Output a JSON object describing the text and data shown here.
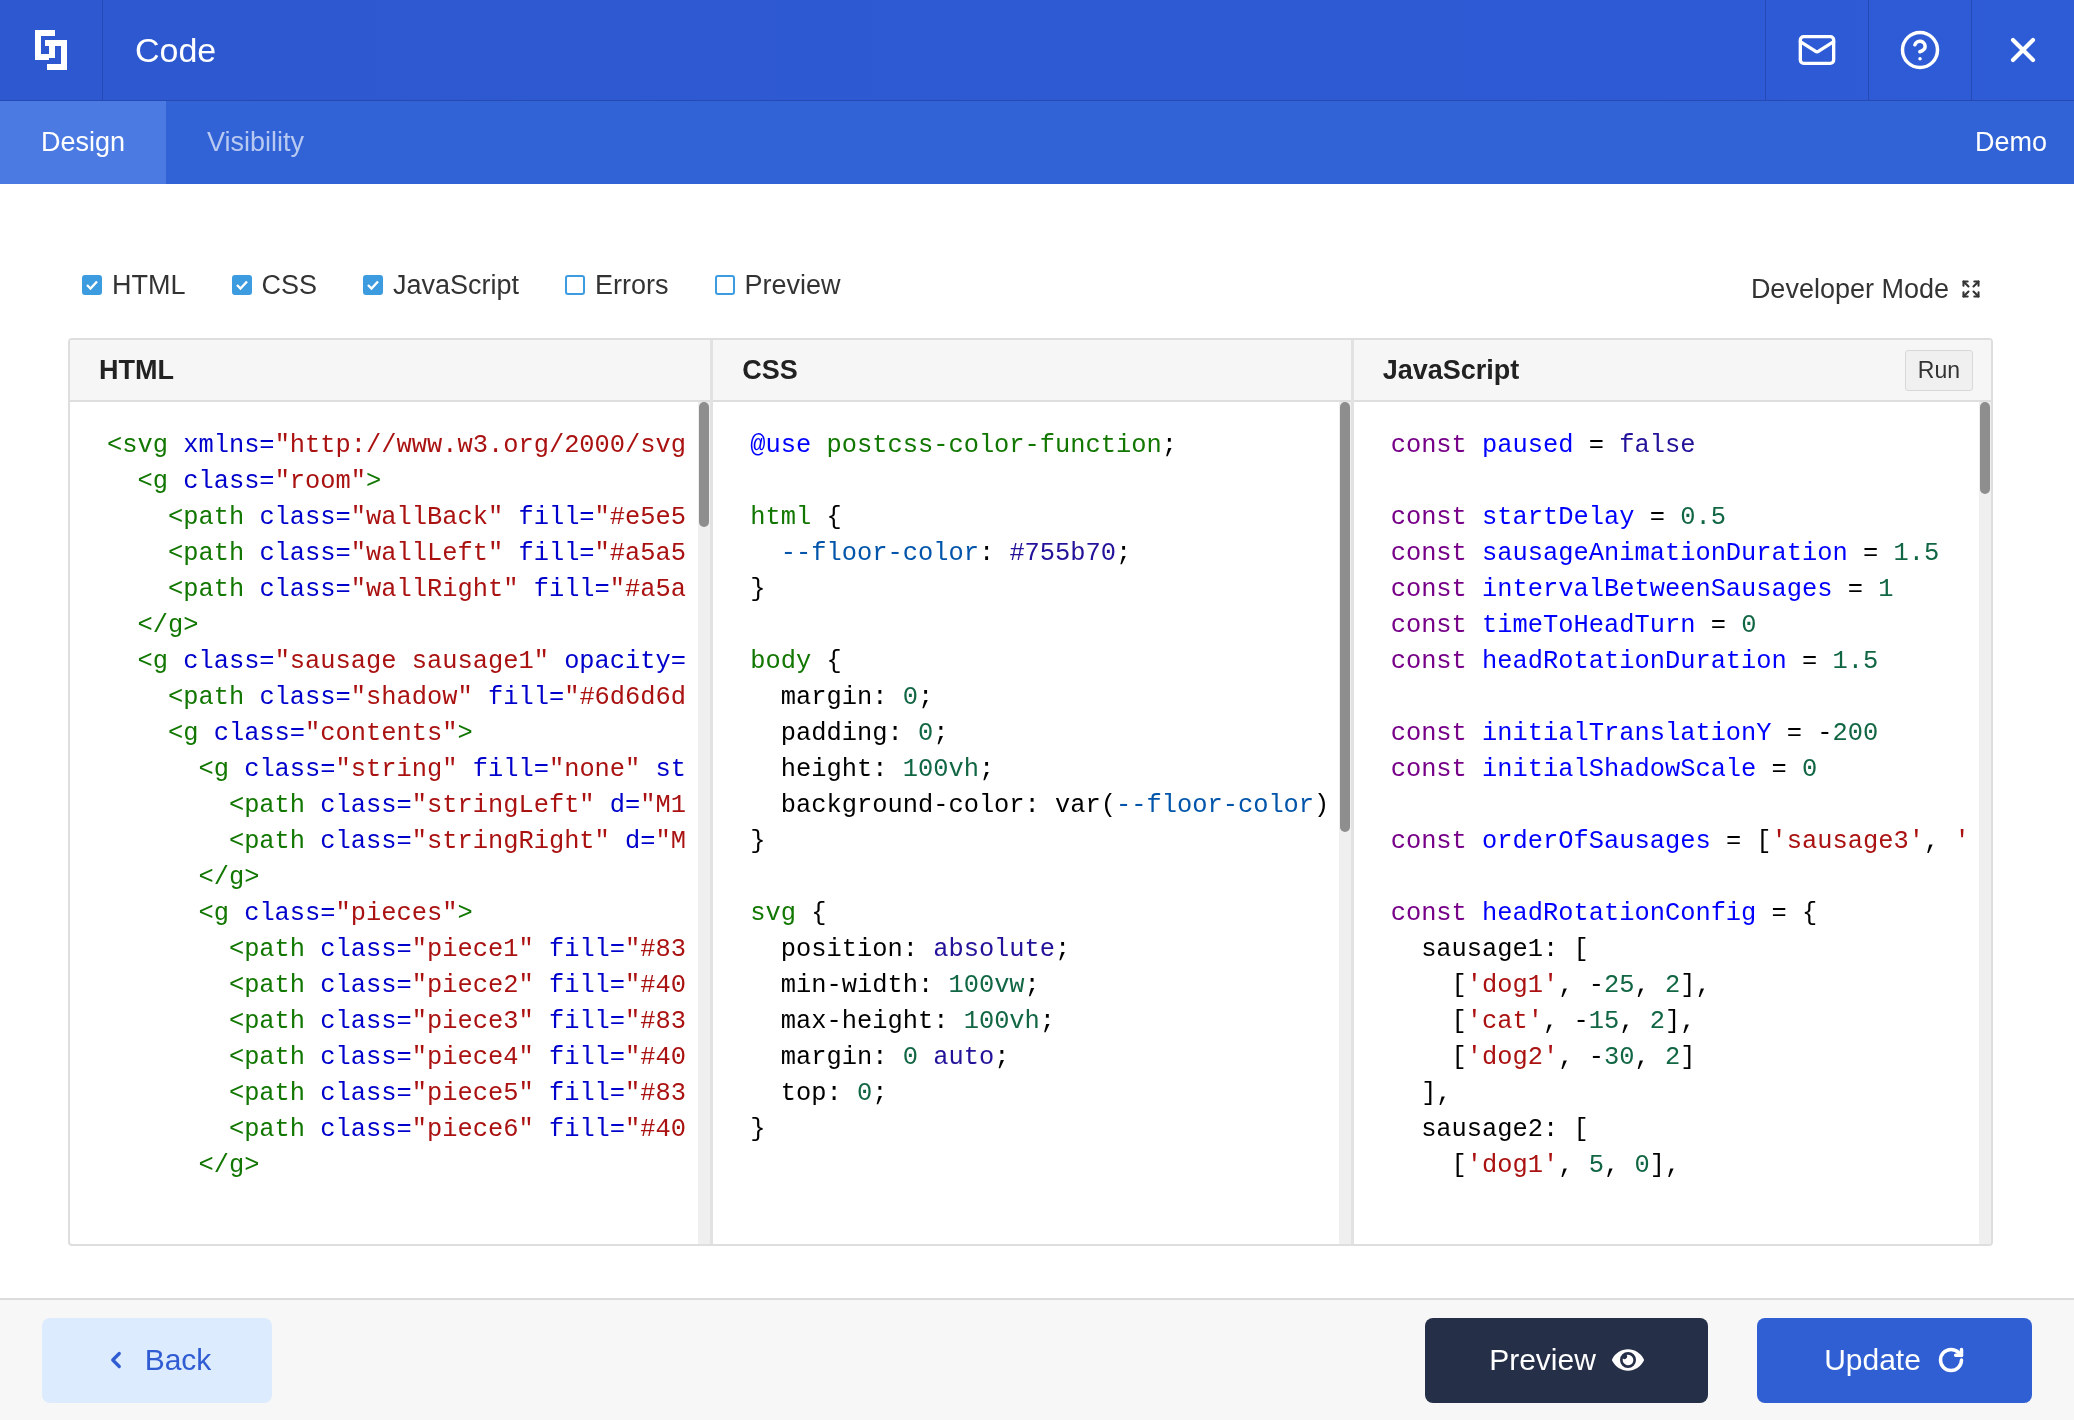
{
  "header": {
    "title": "Code"
  },
  "tabs": [
    {
      "label": "Design",
      "selected": true
    },
    {
      "label": "Visibility",
      "selected": false
    }
  ],
  "demo_label": "Demo",
  "toggles": [
    {
      "label": "HTML",
      "checked": true
    },
    {
      "label": "CSS",
      "checked": true
    },
    {
      "label": "JavaScript",
      "checked": true
    },
    {
      "label": "Errors",
      "checked": false
    },
    {
      "label": "Preview",
      "checked": false
    }
  ],
  "developer_mode": {
    "label": "Developer Mode"
  },
  "editors": [
    {
      "title": "HTML",
      "lines": [
        {
          "tokens": [
            {
              "kind": "tag",
              "text": "<svg"
            },
            {
              "kind": "attribute",
              "text": " xmlns="
            },
            {
              "kind": "string",
              "text": "\"http://www.w3.org/2000/svg"
            }
          ]
        },
        {
          "tokens": [
            {
              "kind": "tag",
              "text": "  <g"
            },
            {
              "kind": "attribute",
              "text": " class="
            },
            {
              "kind": "string",
              "text": "\"room\""
            },
            {
              "kind": "tag",
              "text": ">"
            }
          ]
        },
        {
          "tokens": [
            {
              "kind": "tag",
              "text": "    <path"
            },
            {
              "kind": "attribute",
              "text": " class="
            },
            {
              "kind": "string",
              "text": "\"wallBack\""
            },
            {
              "kind": "attribute",
              "text": " fill="
            },
            {
              "kind": "string",
              "text": "\"#e5e5"
            }
          ]
        },
        {
          "tokens": [
            {
              "kind": "tag",
              "text": "    <path"
            },
            {
              "kind": "attribute",
              "text": " class="
            },
            {
              "kind": "string",
              "text": "\"wallLeft\""
            },
            {
              "kind": "attribute",
              "text": " fill="
            },
            {
              "kind": "string",
              "text": "\"#a5a5"
            }
          ]
        },
        {
          "tokens": [
            {
              "kind": "tag",
              "text": "    <path"
            },
            {
              "kind": "attribute",
              "text": " class="
            },
            {
              "kind": "string",
              "text": "\"wallRight\""
            },
            {
              "kind": "attribute",
              "text": " fill="
            },
            {
              "kind": "string",
              "text": "\"#a5a"
            }
          ]
        },
        {
          "tokens": [
            {
              "kind": "tag",
              "text": "  </g>"
            }
          ]
        },
        {
          "tokens": [
            {
              "kind": "tag",
              "text": "  <g"
            },
            {
              "kind": "attribute",
              "text": " class="
            },
            {
              "kind": "string",
              "text": "\"sausage sausage1\""
            },
            {
              "kind": "attribute",
              "text": " opacity="
            }
          ]
        },
        {
          "tokens": [
            {
              "kind": "tag",
              "text": "    <path"
            },
            {
              "kind": "attribute",
              "text": " class="
            },
            {
              "kind": "string",
              "text": "\"shadow\""
            },
            {
              "kind": "attribute",
              "text": " fill="
            },
            {
              "kind": "string",
              "text": "\"#6d6d6d"
            }
          ]
        },
        {
          "tokens": [
            {
              "kind": "tag",
              "text": "    <g"
            },
            {
              "kind": "attribute",
              "text": " class="
            },
            {
              "kind": "string",
              "text": "\"contents\""
            },
            {
              "kind": "tag",
              "text": ">"
            }
          ]
        },
        {
          "tokens": [
            {
              "kind": "tag",
              "text": "      <g"
            },
            {
              "kind": "attribute",
              "text": " class="
            },
            {
              "kind": "string",
              "text": "\"string\""
            },
            {
              "kind": "attribute",
              "text": " fill="
            },
            {
              "kind": "string",
              "text": "\"none\""
            },
            {
              "kind": "attribute",
              "text": " st"
            }
          ]
        },
        {
          "tokens": [
            {
              "kind": "tag",
              "text": "        <path"
            },
            {
              "kind": "attribute",
              "text": " class="
            },
            {
              "kind": "string",
              "text": "\"stringLeft\""
            },
            {
              "kind": "attribute",
              "text": " d="
            },
            {
              "kind": "string",
              "text": "\"M1"
            }
          ]
        },
        {
          "tokens": [
            {
              "kind": "tag",
              "text": "        <path"
            },
            {
              "kind": "attribute",
              "text": " class="
            },
            {
              "kind": "string",
              "text": "\"stringRight\""
            },
            {
              "kind": "attribute",
              "text": " d="
            },
            {
              "kind": "string",
              "text": "\"M"
            }
          ]
        },
        {
          "tokens": [
            {
              "kind": "tag",
              "text": "      </g>"
            }
          ]
        },
        {
          "tokens": [
            {
              "kind": "tag",
              "text": "      <g"
            },
            {
              "kind": "attribute",
              "text": " class="
            },
            {
              "kind": "string",
              "text": "\"pieces\""
            },
            {
              "kind": "tag",
              "text": ">"
            }
          ]
        },
        {
          "tokens": [
            {
              "kind": "tag",
              "text": "        <path"
            },
            {
              "kind": "attribute",
              "text": " class="
            },
            {
              "kind": "string",
              "text": "\"piece1\""
            },
            {
              "kind": "attribute",
              "text": " fill="
            },
            {
              "kind": "string",
              "text": "\"#83"
            }
          ]
        },
        {
          "tokens": [
            {
              "kind": "tag",
              "text": "        <path"
            },
            {
              "kind": "attribute",
              "text": " class="
            },
            {
              "kind": "string",
              "text": "\"piece2\""
            },
            {
              "kind": "attribute",
              "text": " fill="
            },
            {
              "kind": "string",
              "text": "\"#40"
            }
          ]
        },
        {
          "tokens": [
            {
              "kind": "tag",
              "text": "        <path"
            },
            {
              "kind": "attribute",
              "text": " class="
            },
            {
              "kind": "string",
              "text": "\"piece3\""
            },
            {
              "kind": "attribute",
              "text": " fill="
            },
            {
              "kind": "string",
              "text": "\"#83"
            }
          ]
        },
        {
          "tokens": [
            {
              "kind": "tag",
              "text": "        <path"
            },
            {
              "kind": "attribute",
              "text": " class="
            },
            {
              "kind": "string",
              "text": "\"piece4\""
            },
            {
              "kind": "attribute",
              "text": " fill="
            },
            {
              "kind": "string",
              "text": "\"#40"
            }
          ]
        },
        {
          "tokens": [
            {
              "kind": "tag",
              "text": "        <path"
            },
            {
              "kind": "attribute",
              "text": " class="
            },
            {
              "kind": "string",
              "text": "\"piece5\""
            },
            {
              "kind": "attribute",
              "text": " fill="
            },
            {
              "kind": "string",
              "text": "\"#83"
            }
          ]
        },
        {
          "tokens": [
            {
              "kind": "tag",
              "text": "        <path"
            },
            {
              "kind": "attribute",
              "text": " class="
            },
            {
              "kind": "string",
              "text": "\"piece6\""
            },
            {
              "kind": "attribute",
              "text": " fill="
            },
            {
              "kind": "string",
              "text": "\"#40"
            }
          ]
        },
        {
          "tokens": [
            {
              "kind": "tag",
              "text": "      </g>"
            }
          ]
        }
      ]
    },
    {
      "title": "CSS",
      "lines": [
        {
          "tokens": [
            {
              "kind": "def",
              "text": "@use"
            },
            {
              "kind": "tag",
              "text": " postcss-color-function"
            },
            {
              "kind": "plain",
              "text": ";"
            }
          ]
        },
        {
          "gap_before": true,
          "tokens": [
            {
              "kind": "tag",
              "text": "html"
            },
            {
              "kind": "plain",
              "text": " {"
            }
          ]
        },
        {
          "tokens": [
            {
              "kind": "variable",
              "text": "  --floor-color"
            },
            {
              "kind": "plain",
              "text": ": "
            },
            {
              "kind": "atom",
              "text": "#755b70"
            },
            {
              "kind": "plain",
              "text": ";"
            }
          ]
        },
        {
          "tokens": [
            {
              "kind": "plain",
              "text": "}"
            }
          ]
        },
        {
          "gap_before": true,
          "tokens": [
            {
              "kind": "tag",
              "text": "body"
            },
            {
              "kind": "plain",
              "text": " {"
            }
          ]
        },
        {
          "tokens": [
            {
              "kind": "plain",
              "text": "  margin: "
            },
            {
              "kind": "number",
              "text": "0"
            },
            {
              "kind": "plain",
              "text": ";"
            }
          ]
        },
        {
          "tokens": [
            {
              "kind": "plain",
              "text": "  padding: "
            },
            {
              "kind": "number",
              "text": "0"
            },
            {
              "kind": "plain",
              "text": ";"
            }
          ]
        },
        {
          "tokens": [
            {
              "kind": "plain",
              "text": "  height: "
            },
            {
              "kind": "number",
              "text": "100vh"
            },
            {
              "kind": "plain",
              "text": ";"
            }
          ]
        },
        {
          "tokens": [
            {
              "kind": "plain",
              "text": "  background-color: var("
            },
            {
              "kind": "variable",
              "text": "--floor-color"
            },
            {
              "kind": "plain",
              "text": ")"
            }
          ]
        },
        {
          "tokens": [
            {
              "kind": "plain",
              "text": "}"
            }
          ]
        },
        {
          "gap_before": true,
          "tokens": [
            {
              "kind": "tag",
              "text": "svg"
            },
            {
              "kind": "plain",
              "text": " {"
            }
          ]
        },
        {
          "tokens": [
            {
              "kind": "plain",
              "text": "  position: "
            },
            {
              "kind": "atom",
              "text": "absolute"
            },
            {
              "kind": "plain",
              "text": ";"
            }
          ]
        },
        {
          "tokens": [
            {
              "kind": "plain",
              "text": "  min-width: "
            },
            {
              "kind": "number",
              "text": "100vw"
            },
            {
              "kind": "plain",
              "text": ";"
            }
          ]
        },
        {
          "tokens": [
            {
              "kind": "plain",
              "text": "  max-height: "
            },
            {
              "kind": "number",
              "text": "100vh"
            },
            {
              "kind": "plain",
              "text": ";"
            }
          ]
        },
        {
          "tokens": [
            {
              "kind": "plain",
              "text": "  margin: "
            },
            {
              "kind": "number",
              "text": "0"
            },
            {
              "kind": "atom",
              "text": " auto"
            },
            {
              "kind": "plain",
              "text": ";"
            }
          ]
        },
        {
          "tokens": [
            {
              "kind": "plain",
              "text": "  top: "
            },
            {
              "kind": "number",
              "text": "0"
            },
            {
              "kind": "plain",
              "text": ";"
            }
          ]
        },
        {
          "tokens": [
            {
              "kind": "plain",
              "text": "}"
            }
          ]
        }
      ]
    },
    {
      "title": "JavaScript",
      "run_button": "Run",
      "lines": [
        {
          "tokens": [
            {
              "kind": "keyword",
              "text": "const"
            },
            {
              "kind": "def",
              "text": " paused"
            },
            {
              "kind": "plain",
              "text": " = "
            },
            {
              "kind": "atom",
              "text": "false"
            }
          ]
        },
        {
          "gap_before": true,
          "tokens": [
            {
              "kind": "keyword",
              "text": "const"
            },
            {
              "kind": "def",
              "text": " startDelay"
            },
            {
              "kind": "plain",
              "text": " = "
            },
            {
              "kind": "number",
              "text": "0.5"
            }
          ]
        },
        {
          "tokens": [
            {
              "kind": "keyword",
              "text": "const"
            },
            {
              "kind": "def",
              "text": " sausageAnimationDuration"
            },
            {
              "kind": "plain",
              "text": " = "
            },
            {
              "kind": "number",
              "text": "1.5"
            }
          ]
        },
        {
          "tokens": [
            {
              "kind": "keyword",
              "text": "const"
            },
            {
              "kind": "def",
              "text": " intervalBetweenSausages"
            },
            {
              "kind": "plain",
              "text": " = "
            },
            {
              "kind": "number",
              "text": "1"
            }
          ]
        },
        {
          "tokens": [
            {
              "kind": "keyword",
              "text": "const"
            },
            {
              "kind": "def",
              "text": " timeToHeadTurn"
            },
            {
              "kind": "plain",
              "text": " = "
            },
            {
              "kind": "number",
              "text": "0"
            }
          ]
        },
        {
          "tokens": [
            {
              "kind": "keyword",
              "text": "const"
            },
            {
              "kind": "def",
              "text": " headRotationDuration"
            },
            {
              "kind": "plain",
              "text": " = "
            },
            {
              "kind": "number",
              "text": "1.5"
            }
          ]
        },
        {
          "gap_before": true,
          "tokens": [
            {
              "kind": "keyword",
              "text": "const"
            },
            {
              "kind": "def",
              "text": " initialTranslationY"
            },
            {
              "kind": "plain",
              "text": " = -"
            },
            {
              "kind": "number",
              "text": "200"
            }
          ]
        },
        {
          "tokens": [
            {
              "kind": "keyword",
              "text": "const"
            },
            {
              "kind": "def",
              "text": " initialShadowScale"
            },
            {
              "kind": "plain",
              "text": " = "
            },
            {
              "kind": "number",
              "text": "0"
            }
          ]
        },
        {
          "gap_before": true,
          "tokens": [
            {
              "kind": "keyword",
              "text": "const"
            },
            {
              "kind": "def",
              "text": " orderOfSausages"
            },
            {
              "kind": "plain",
              "text": " = ["
            },
            {
              "kind": "string",
              "text": "'sausage3'"
            },
            {
              "kind": "plain",
              "text": ", "
            },
            {
              "kind": "string",
              "text": "'"
            }
          ]
        },
        {
          "gap_before": true,
          "tokens": [
            {
              "kind": "keyword",
              "text": "const"
            },
            {
              "kind": "def",
              "text": " headRotationConfig"
            },
            {
              "kind": "plain",
              "text": " = {"
            }
          ]
        },
        {
          "tokens": [
            {
              "kind": "plain",
              "text": "  sausage1: ["
            }
          ]
        },
        {
          "tokens": [
            {
              "kind": "plain",
              "text": "    ["
            },
            {
              "kind": "string",
              "text": "'dog1'"
            },
            {
              "kind": "plain",
              "text": ", -"
            },
            {
              "kind": "number",
              "text": "25"
            },
            {
              "kind": "plain",
              "text": ", "
            },
            {
              "kind": "number",
              "text": "2"
            },
            {
              "kind": "plain",
              "text": "],"
            }
          ]
        },
        {
          "tokens": [
            {
              "kind": "plain",
              "text": "    ["
            },
            {
              "kind": "string",
              "text": "'cat'"
            },
            {
              "kind": "plain",
              "text": ", -"
            },
            {
              "kind": "number",
              "text": "15"
            },
            {
              "kind": "plain",
              "text": ", "
            },
            {
              "kind": "number",
              "text": "2"
            },
            {
              "kind": "plain",
              "text": "],"
            }
          ]
        },
        {
          "tokens": [
            {
              "kind": "plain",
              "text": "    ["
            },
            {
              "kind": "string",
              "text": "'dog2'"
            },
            {
              "kind": "plain",
              "text": ", -"
            },
            {
              "kind": "number",
              "text": "30"
            },
            {
              "kind": "plain",
              "text": ", "
            },
            {
              "kind": "number",
              "text": "2"
            },
            {
              "kind": "plain",
              "text": "]"
            }
          ]
        },
        {
          "tokens": [
            {
              "kind": "plain",
              "text": "  ],"
            }
          ]
        },
        {
          "tokens": [
            {
              "kind": "plain",
              "text": "  sausage2: ["
            }
          ]
        },
        {
          "tokens": [
            {
              "kind": "plain",
              "text": "    ["
            },
            {
              "kind": "string",
              "text": "'dog1'"
            },
            {
              "kind": "plain",
              "text": ", "
            },
            {
              "kind": "number",
              "text": "5"
            },
            {
              "kind": "plain",
              "text": ", "
            },
            {
              "kind": "number",
              "text": "0"
            },
            {
              "kind": "plain",
              "text": "],"
            }
          ]
        }
      ]
    }
  ],
  "footer": {
    "back": "Back",
    "preview": "Preview",
    "update": "Update"
  }
}
